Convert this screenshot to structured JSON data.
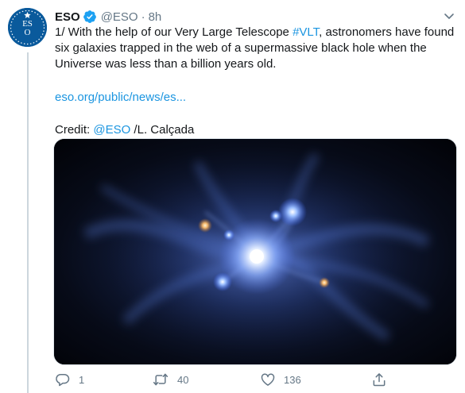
{
  "tweet": {
    "display_name": "ESO",
    "handle": "@ESO",
    "separator": "·",
    "time": "8h",
    "avatar_logo_text": "ES O",
    "body": {
      "line1_prefix": "1/ With the help of our Very Large Telescope ",
      "hashtag": "#VLT",
      "line1_suffix": ", astronomers have found six galaxies trapped in the web of a supermassive black hole when the Universe was less than a billion years old.",
      "link": "eso.org/public/news/es...",
      "credit_prefix": "Credit: ",
      "credit_mention": "@ESO",
      "credit_suffix": " /L. Calçada"
    },
    "actions": {
      "reply_count": "1",
      "retweet_count": "40",
      "like_count": "136"
    }
  },
  "colors": {
    "link": "#1b95e0",
    "text": "#14171a",
    "muted": "#657786",
    "verified": "#1da1f2",
    "avatar_bg": "#0a5a9c"
  },
  "icons": {
    "verified": "verified-badge-icon",
    "caret": "chevron-down-icon",
    "reply": "reply-icon",
    "retweet": "retweet-icon",
    "like": "heart-icon",
    "share": "share-icon"
  }
}
